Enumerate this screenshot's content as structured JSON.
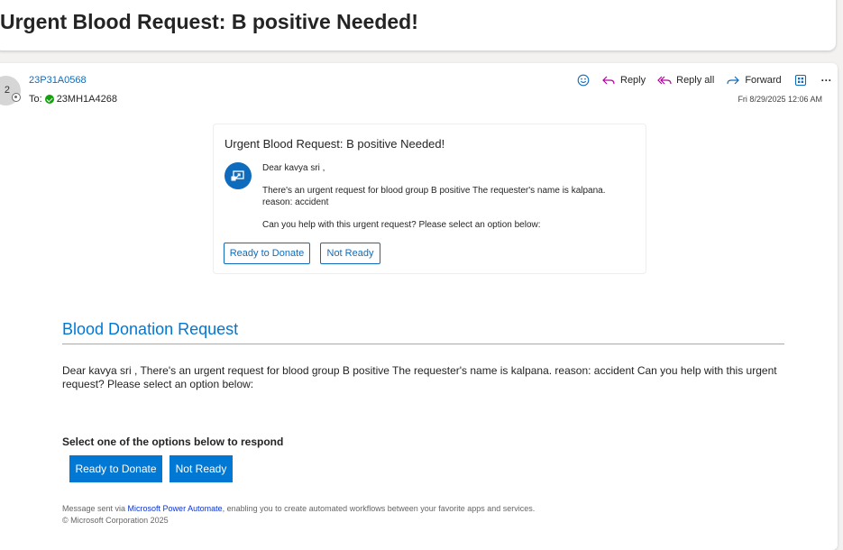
{
  "subject": "Urgent Blood Request: B positive Needed!",
  "header": {
    "avatar_initials": "2",
    "sender": "23P31A0568",
    "to_label": "To:",
    "recipient": "23MH1A4268",
    "date": "Fri 8/29/2025 12:06 AM",
    "actions": {
      "emoji_icon": "smiley-icon",
      "reply": "Reply",
      "reply_all": "Reply all",
      "forward": "Forward",
      "apps_icon": "apps-icon",
      "more": "···"
    }
  },
  "card": {
    "title": "Urgent Blood Request: B positive Needed!",
    "icon": "power-automate-icon",
    "greeting": "Dear kavya sri ,",
    "line1": "There's an urgent request for blood group B positive The requester's name is kalpana.",
    "line2": "reason: accident",
    "question": "Can you help with this urgent request? Please select an option below:",
    "btn_ready": "Ready to Donate",
    "btn_not_ready": "Not Ready"
  },
  "body": {
    "heading": "Blood Donation Request",
    "paragraph": "Dear kavya sri , There's an urgent request for blood group B positive The requester's name is kalpana. reason: accident Can you help with this urgent request? Please select an option below:",
    "select_prompt": "Select one of the options below to respond",
    "btn_ready": "Ready to Donate",
    "btn_not_ready": "Not Ready",
    "footer_prefix": "Message sent via ",
    "footer_link": "Microsoft Power Automate",
    "footer_suffix": ", enabling you to create automated workflows between your favorite apps and services.",
    "copyright": "© Microsoft Corporation 2025"
  },
  "colors": {
    "accent": "#0078d4",
    "link": "#0f6cbd",
    "presence_available": "#13a10e"
  }
}
